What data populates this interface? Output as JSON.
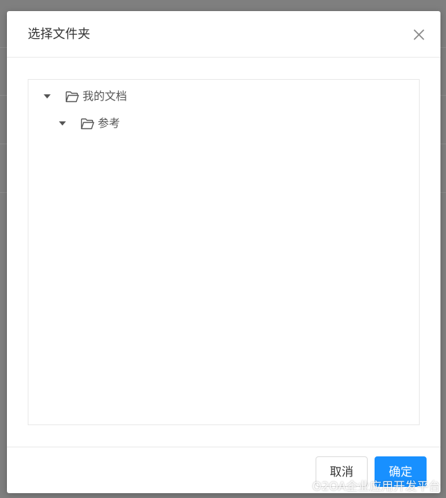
{
  "dialog": {
    "title": "选择文件夹",
    "close_icon": "close-icon"
  },
  "tree": {
    "nodes": [
      {
        "label": "我的文档",
        "expanded": true,
        "level": 0,
        "icon": "folder-open-icon"
      },
      {
        "label": "参考",
        "expanded": true,
        "level": 1,
        "icon": "folder-open-icon"
      }
    ]
  },
  "footer": {
    "cancel_label": "取消",
    "ok_label": "确定"
  },
  "watermark": "O2OA企业应用开发平台",
  "colors": {
    "primary": "#1890ff",
    "overlay": "#7f7f7f",
    "border": "#e8e8e8",
    "text": "#333333",
    "caret": "#555555"
  }
}
